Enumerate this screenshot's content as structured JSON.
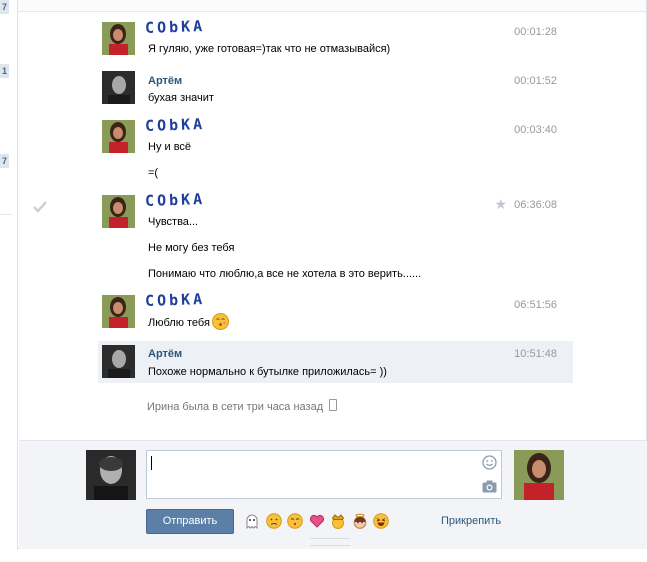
{
  "gutter": {
    "badges": [
      "7",
      "1",
      "7"
    ]
  },
  "messages": [
    {
      "author": "CObKA",
      "author_style": "script",
      "time": "00:01:28",
      "lines": [
        "Я гуляю, уже готовая=)так что не отмазывайся)"
      ]
    },
    {
      "author": "Артём",
      "author_style": "link",
      "time": "00:01:52",
      "lines": [
        "бухая значит"
      ]
    },
    {
      "author": "CObKA",
      "author_style": "script",
      "time": "00:03:40",
      "lines": [
        "Ну и всё",
        "=("
      ]
    },
    {
      "author": "CObKA",
      "author_style": "script",
      "time": "06:36:08",
      "lines": [
        "Чувства...",
        "Не могу без тебя",
        "Понимаю что люблю,а все не хотела в это верить......"
      ]
    },
    {
      "author": "CObKA",
      "author_style": "script",
      "time": "06:51:56",
      "lines": [
        "Люблю тебя"
      ]
    },
    {
      "author": "Артём",
      "author_style": "link",
      "time": "10:51:48",
      "lines": [
        "Похоже нормально к бутылке приложилась= ))"
      ]
    }
  ],
  "status_note": "Ирина была в сети три часа назад",
  "composer": {
    "input_value": "",
    "send_label": "Отправить",
    "attach_label": "Прикрепить",
    "quick_emoji": [
      "ghost-emoji",
      "sad-emoji",
      "kiss-emoji",
      "heart-emoji",
      "crown-emoji",
      "angel-emoji",
      "laugh-emoji"
    ]
  },
  "colors": {
    "accent": "#2b587a",
    "button": "#5b7fa6",
    "highlight": "#edf1f5",
    "script_name": "#1e3f9c"
  }
}
